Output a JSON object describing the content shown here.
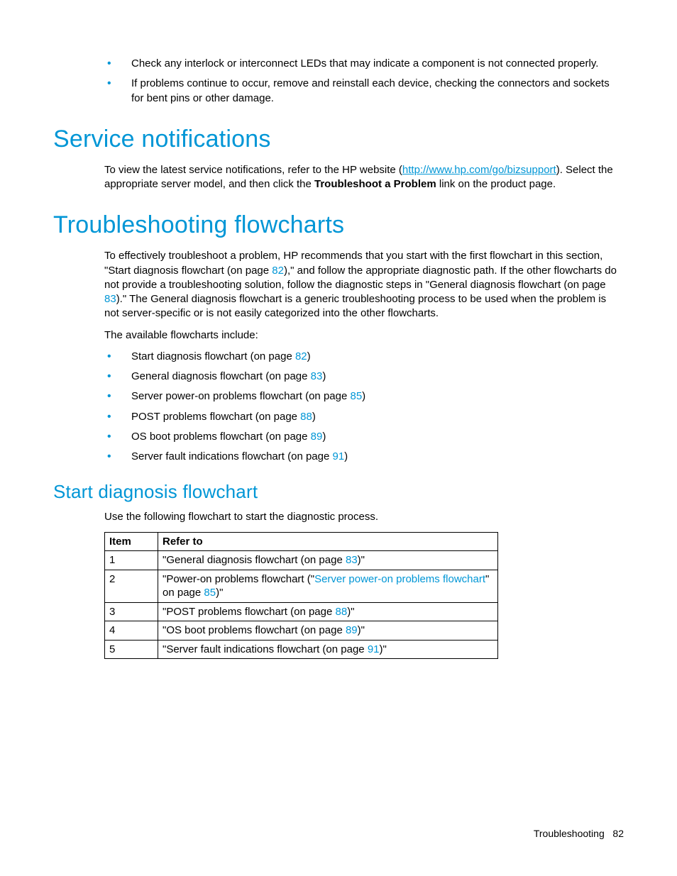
{
  "top_bullets": [
    "Check any interlock or interconnect LEDs that may indicate a component is not connected properly.",
    "If problems continue to occur, remove and reinstall each device, checking the connectors and sockets for bent pins or other damage."
  ],
  "service_notifications": {
    "heading": "Service notifications",
    "para_pre": "To view the latest service notifications, refer to the HP website (",
    "link_text": "http://www.hp.com/go/bizsupport",
    "para_post1": "). Select the appropriate server model, and then click the ",
    "bold_text": "Troubleshoot a Problem",
    "para_post2": " link on the product page."
  },
  "troubleshooting_flowcharts": {
    "heading": "Troubleshooting flowcharts",
    "para1_pre": "To effectively troubleshoot a problem, HP recommends that you start with the first flowchart in this section, \"Start diagnosis flowchart (on page ",
    "ref1": "82",
    "para1_mid": "),\" and follow the appropriate diagnostic path. If the other flowcharts do not provide a troubleshooting solution, follow the diagnostic steps in \"General diagnosis flowchart (on page ",
    "ref2": "83",
    "para1_post": ").\" The General diagnosis flowchart is a generic troubleshooting process to be used when the problem is not server-specific or is not easily categorized into the other flowcharts.",
    "para2": "The available flowcharts include:",
    "items": [
      {
        "pre": "Start diagnosis flowchart (on page ",
        "ref": "82",
        "post": ")"
      },
      {
        "pre": "General diagnosis flowchart (on page ",
        "ref": "83",
        "post": ")"
      },
      {
        "pre": "Server power-on problems flowchart (on page ",
        "ref": "85",
        "post": ")"
      },
      {
        "pre": "POST problems flowchart (on page ",
        "ref": "88",
        "post": ")"
      },
      {
        "pre": "OS boot problems flowchart (on page ",
        "ref": "89",
        "post": ")"
      },
      {
        "pre": "Server fault indications flowchart (on page ",
        "ref": "91",
        "post": ")"
      }
    ]
  },
  "start_diagnosis": {
    "heading": "Start diagnosis flowchart",
    "para": "Use the following flowchart to start the diagnostic process.",
    "table_headers": {
      "item": "Item",
      "refer": "Refer to"
    },
    "rows": [
      {
        "item": "1",
        "pre": "\"General diagnosis flowchart (on page ",
        "ref": "83",
        "post": ")\"",
        "link_mid": ""
      },
      {
        "item": "2",
        "pre": "\"Power-on problems flowchart (\"",
        "ref": "85",
        "post": ")\"",
        "link_mid": "Server power-on problems flowchart",
        "mid2": "\" on page "
      },
      {
        "item": "3",
        "pre": "\"POST problems flowchart (on page ",
        "ref": "88",
        "post": ")\"",
        "link_mid": ""
      },
      {
        "item": "4",
        "pre": "\"OS boot problems flowchart (on page ",
        "ref": "89",
        "post": ")\"",
        "link_mid": ""
      },
      {
        "item": "5",
        "pre": "\"Server fault indications flowchart (on page ",
        "ref": "91",
        "post": ")\"",
        "link_mid": ""
      }
    ]
  },
  "footer": {
    "section": "Troubleshooting",
    "page": "82"
  }
}
